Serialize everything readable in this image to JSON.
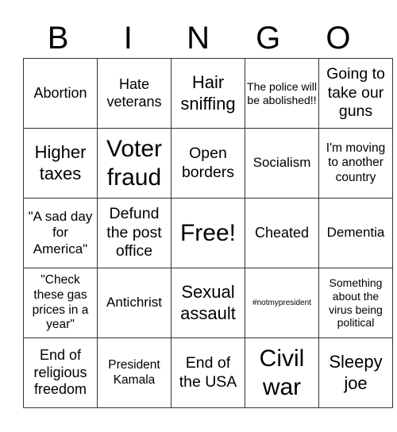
{
  "header": {
    "letters": [
      "B",
      "I",
      "N",
      "G",
      "O"
    ]
  },
  "board": {
    "rows": [
      [
        "Abortion",
        "Hate veterans",
        "Hair sniffing",
        "The police will be abolished!!",
        "Going to take our guns"
      ],
      [
        "Higher taxes",
        "Voter fraud",
        "Open borders",
        "Socialism",
        "I'm moving to another country"
      ],
      [
        "\"A sad day for America\"",
        "Defund the post office",
        "Free!",
        "Cheated",
        "Dementia"
      ],
      [
        "\"Check these gas prices in a year\"",
        "Antichrist",
        "Sexual assault",
        "#notmypresident",
        "Something about the virus being political"
      ],
      [
        "End of religious freedom",
        "President Kamala",
        "End of the USA",
        "Civil war",
        "Sleepy joe"
      ]
    ]
  }
}
